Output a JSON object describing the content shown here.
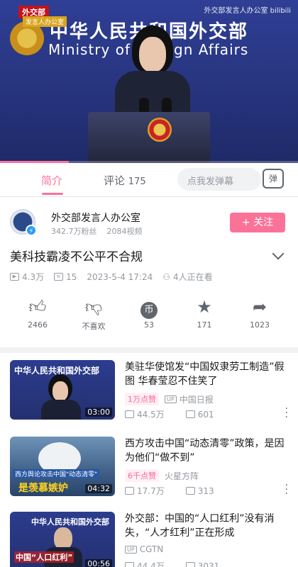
{
  "player": {
    "channel_tag": "外交部",
    "channel_tag_sub": "发言人办公室",
    "watermark": "外交部发言人办公室 bilibili",
    "banner_cn": "中华人民共和国外交部",
    "banner_en": "Ministry of Foreign Affairs",
    "progress_fraction": 0.23
  },
  "tabs": [
    {
      "label": "简介",
      "active": true
    },
    {
      "label": "评论",
      "count": "175",
      "active": false
    }
  ],
  "danmu": {
    "placeholder": "点我发弹幕",
    "toggle_label": "弹"
  },
  "uploader": {
    "name": "外交部发言人办公室",
    "fans": "342.7万粉丝",
    "videos": "2084视频",
    "follow_label": "+ 关注"
  },
  "video": {
    "title": "美科技霸凌不公平不合规",
    "views": "4.3万",
    "danmaku": "15",
    "datetime": "2023-5-4 17:24",
    "watching": "4人正在看"
  },
  "actions": [
    {
      "icon": "thumbs-up-icon",
      "count": "2466"
    },
    {
      "icon": "thumbs-down-icon",
      "count": "不喜欢"
    },
    {
      "icon": "coin-icon",
      "count": "53"
    },
    {
      "icon": "star-icon",
      "count": "171"
    },
    {
      "icon": "share-icon",
      "count": "1023"
    }
  ],
  "recommendations": [
    {
      "title": "美驻华使馆发“中国奴隶劳工制造”假图 华春莹忍不住笑了",
      "badge": "1万点赞",
      "uploader": "中国日报",
      "views": "44.5万",
      "danmaku": "601",
      "duration": "03:00",
      "thumb_text": ""
    },
    {
      "title": "西方攻击中国“动态清零”政策，是因为他们“做不到”",
      "badge": "6千点赞",
      "uploader": "火星方阵",
      "views": "17.7万",
      "danmaku": "313",
      "duration": "04:32",
      "thumb_text": "是羡慕嫉妒"
    },
    {
      "title": "外交部：中国的“人口红利”没有消失，“人才红利”正在形成",
      "badge": "",
      "uploader": "CGTN",
      "views": "44.4万",
      "danmaku": "3031",
      "duration": "00:56",
      "thumb_text": "中国“人口红利”"
    }
  ]
}
